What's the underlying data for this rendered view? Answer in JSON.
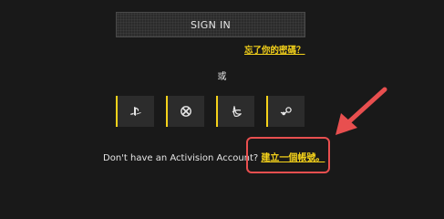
{
  "signin": {
    "label": "SIGN IN"
  },
  "forgot": {
    "label": "忘了你的密碼？"
  },
  "separator": {
    "label": "或"
  },
  "platforms": [
    {
      "icon": "playstation-icon"
    },
    {
      "icon": "xbox-icon"
    },
    {
      "icon": "battlenet-icon"
    },
    {
      "icon": "steam-icon"
    }
  ],
  "signup": {
    "prompt": "Don't have an Activision Account? ",
    "link_label": "建立一個帳號。"
  },
  "colors": {
    "accent": "#f5d21a",
    "annotation": "#e84f4f",
    "background": "#191919"
  }
}
